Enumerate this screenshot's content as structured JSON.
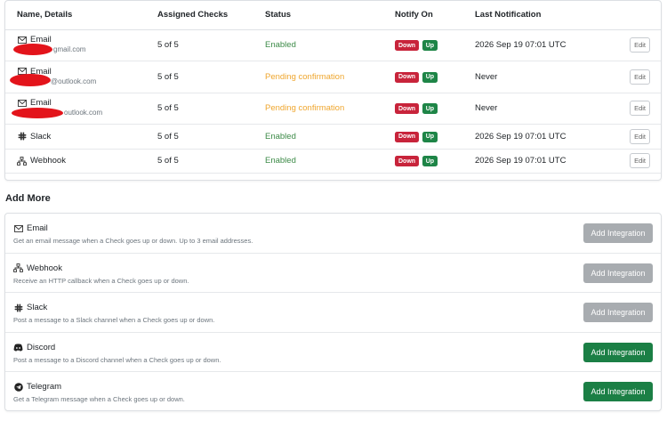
{
  "table": {
    "headers": {
      "name": "Name, Details",
      "checks": "Assigned Checks",
      "status": "Status",
      "notify": "Notify On",
      "last": "Last Notification"
    },
    "rows": [
      {
        "name": "Email",
        "icon": "envelope-icon",
        "detail": "gmail.com",
        "checks": "5 of 5",
        "status": "Enabled",
        "down": "Down",
        "up": "Up",
        "last": "2026 Sep 19 07:01 UTC",
        "edit": "Edit"
      },
      {
        "name": "Email",
        "icon": "envelope-icon",
        "detail": "@outlook.com",
        "checks": "5 of 5",
        "status": "Pending confirmation",
        "down": "Down",
        "up": "Up",
        "last": "Never",
        "edit": "Edit"
      },
      {
        "name": "Email",
        "icon": "envelope-icon",
        "detail": "outlook.com",
        "checks": "5 of 5",
        "status": "Pending confirmation",
        "down": "Down",
        "up": "Up",
        "last": "Never",
        "edit": "Edit"
      },
      {
        "name": "Slack",
        "icon": "slack-icon",
        "checks": "5 of 5",
        "status": "Enabled",
        "down": "Down",
        "up": "Up",
        "last": "2026 Sep 19 07:01 UTC",
        "edit": "Edit"
      },
      {
        "name": "Webhook",
        "icon": "webhook-icon",
        "checks": "5 of 5",
        "status": "Enabled",
        "down": "Down",
        "up": "Up",
        "last": "2026 Sep 19 07:01 UTC",
        "edit": "Edit"
      }
    ]
  },
  "add_more": {
    "title": "Add More",
    "items": [
      {
        "name": "Email",
        "icon": "envelope-icon",
        "desc": "Get an email message when a Check goes up or down. Up to 3 email addresses.",
        "button": "Add Integration",
        "enabled": false
      },
      {
        "name": "Webhook",
        "icon": "webhook-icon",
        "desc": "Receive an HTTP callback when a Check goes up or down.",
        "button": "Add Integration",
        "enabled": false
      },
      {
        "name": "Slack",
        "icon": "slack-icon",
        "desc": "Post a message to a Slack channel when a Check goes up or down.",
        "button": "Add Integration",
        "enabled": false
      },
      {
        "name": "Discord",
        "icon": "discord-icon",
        "desc": "Post a message to a Discord channel when a Check goes up or down.",
        "button": "Add Integration",
        "enabled": true
      },
      {
        "name": "Telegram",
        "icon": "telegram-icon",
        "desc": "Get a Telegram message when a Check goes up or down.",
        "button": "Add Integration",
        "enabled": true
      }
    ]
  },
  "colors": {
    "enabled": "#3d8b48",
    "pending": "#efa62e",
    "down_badge": "#c8243b",
    "up_badge": "#1e8547",
    "add_button_active": "#1b7f45",
    "add_button_disabled": "#a8acb0"
  }
}
